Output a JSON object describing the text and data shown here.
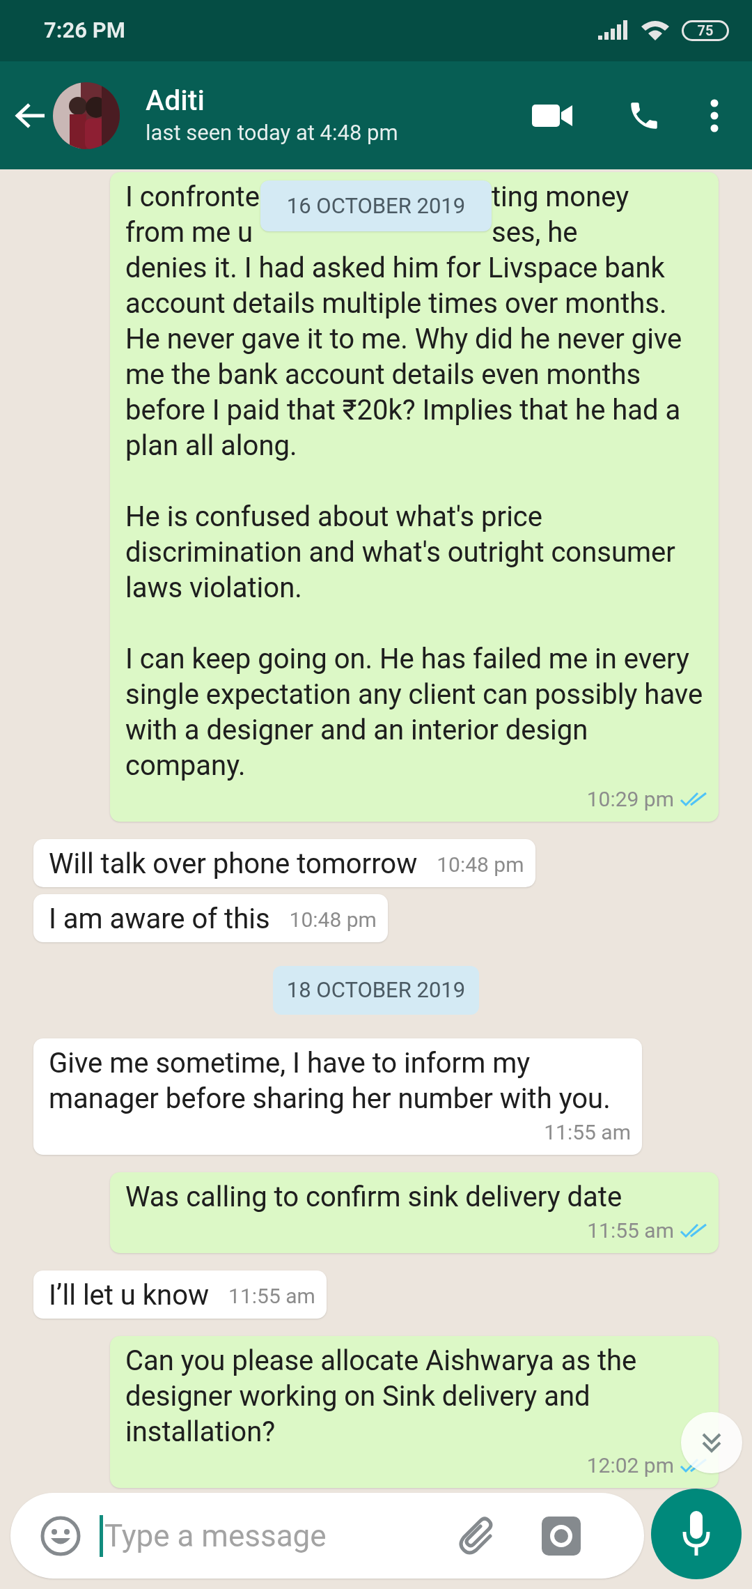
{
  "status_bar": {
    "time": "7:26 PM",
    "battery": "75"
  },
  "header": {
    "name": "Aditi",
    "last_seen": "last seen today at 4:48 pm"
  },
  "floating_date": "16 OCTOBER 2019",
  "messages": [
    {
      "kind": "outgoing",
      "covered_lines": [
        [
          "I confronte",
          "ting money"
        ],
        [
          "from me u",
          "ses, he"
        ]
      ],
      "text": "denies it. I had asked him for Livspace bank account details multiple times over months. He never gave it to me. Why did he never give me the bank account details even months before I paid that ₹20k? Implies that he had a plan all along.\n\nHe is confused about what's price discrimination and what's outright consumer laws violation.\n\nI can keep going on. He has failed me in every single expectation any client can possibly have with a designer and an interior design company.",
      "time": "10:29 pm",
      "read": true
    },
    {
      "kind": "incoming",
      "text": "Will talk over phone tomorrow",
      "time": "10:48 pm"
    },
    {
      "kind": "incoming",
      "text": "I am aware of this",
      "time": "10:48 pm"
    },
    {
      "kind": "date",
      "text": "18 OCTOBER 2019"
    },
    {
      "kind": "incoming",
      "text": "Give me sometime, I have to inform my manager before sharing her number with you.",
      "time": "11:55 am"
    },
    {
      "kind": "outgoing",
      "text": "Was calling to confirm sink delivery date",
      "time": "11:55 am",
      "read": true
    },
    {
      "kind": "incoming",
      "text": "I’ll let u know",
      "time": "11:55 am"
    },
    {
      "kind": "outgoing",
      "text": "Can you please allocate Aishwarya as the designer working on Sink delivery and installation?",
      "time": "12:02 pm",
      "read": true
    }
  ],
  "composer": {
    "placeholder": "Type a message"
  }
}
